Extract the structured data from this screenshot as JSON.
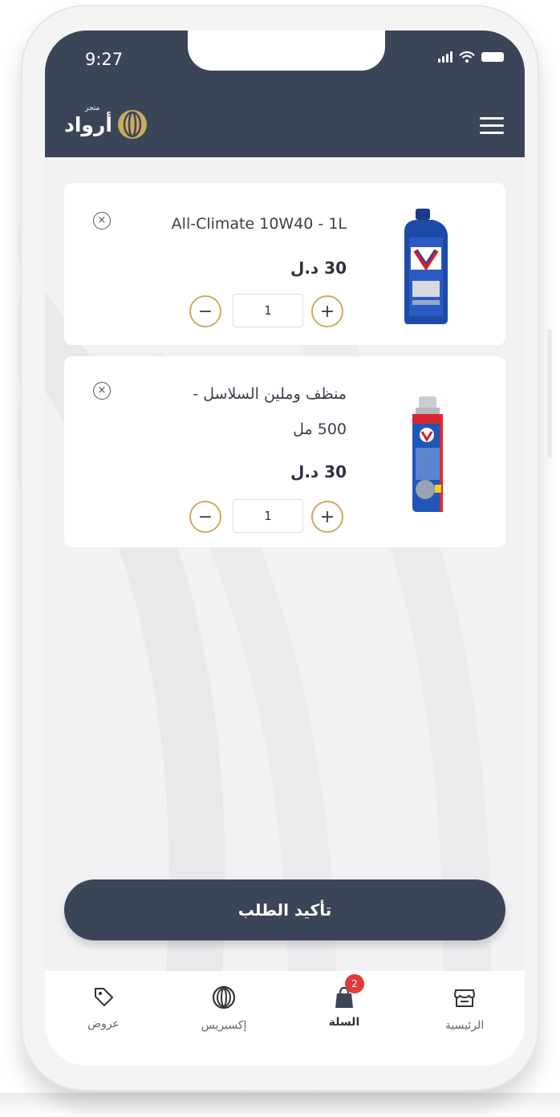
{
  "status_bar": {
    "time": "9:27"
  },
  "header": {
    "logo_small": "متجر",
    "logo_text": "أرواد",
    "menu_icon": "hamburger-icon"
  },
  "cart": {
    "items": [
      {
        "name_line1": "All-Climate 10W40 - 1L",
        "name_line2": "",
        "price": "30 د.ل",
        "quantity": "1",
        "image_icon": "motor-oil-bottle"
      },
      {
        "name_line1": "منظف وملين السلاسل -",
        "name_line2": "500 مل",
        "price": "30 د.ل",
        "quantity": "1",
        "image_icon": "spray-can"
      }
    ],
    "minus": "−",
    "plus": "+",
    "remove": "×"
  },
  "confirm_button": "تأكيد الطلب",
  "tabs": {
    "home": "الرئيسية",
    "cart": "السلة",
    "cart_badge": "2",
    "express": "إكسبريس",
    "offers": "عروض"
  },
  "colors": {
    "header_bg": "#3b4558",
    "accent_gold": "#c8ad5f",
    "badge_red": "#e23b3b"
  }
}
